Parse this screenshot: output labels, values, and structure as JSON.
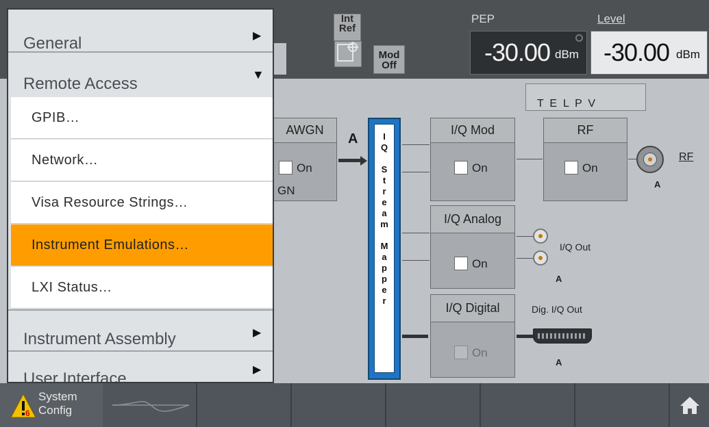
{
  "top": {
    "int_ref": "Int\nRef",
    "mod_off": "Mod\nOff",
    "pep_label": "PEP",
    "level_label": "Level",
    "pep_value": "-30.00",
    "pep_unit": "dBm",
    "level_value": "-30.00",
    "level_unit": "dBm"
  },
  "menu": {
    "general": "General",
    "remote_access": "Remote Access",
    "items": [
      "GPIB…",
      "Network…",
      "Visa Resource Strings…",
      "Instrument Emulations…",
      "LXI Status…"
    ],
    "instrument_assembly": "Instrument Assembly",
    "user_interface": "User Interface"
  },
  "diagram": {
    "awgn_title": "AWGN",
    "awgn_on": "On",
    "awgn_sub": "GN",
    "a_label": "A",
    "mapper_text": "I\nQ\n\nS\nt\nr\ne\na\nm\n\nM\na\np\np\ne\nr",
    "iq_mod_title": "I/Q Mod",
    "iq_mod_on": "On",
    "rf_title": "RF",
    "rf_on": "On",
    "rf_link": "RF",
    "rf_a": "A",
    "telpv": "T  E  L  P  V",
    "iq_analog_title": "I/Q Analog",
    "iq_analog_on": "On",
    "iq_out": "I/Q Out",
    "iq_out_a": "A",
    "iq_digital_title": "I/Q Digital",
    "iq_digital_on": "On",
    "dig_iq_out": "Dig. I/Q Out",
    "dig_a": "A"
  },
  "bottom": {
    "system_config": "System\nConfig",
    "warn_count": "6"
  }
}
